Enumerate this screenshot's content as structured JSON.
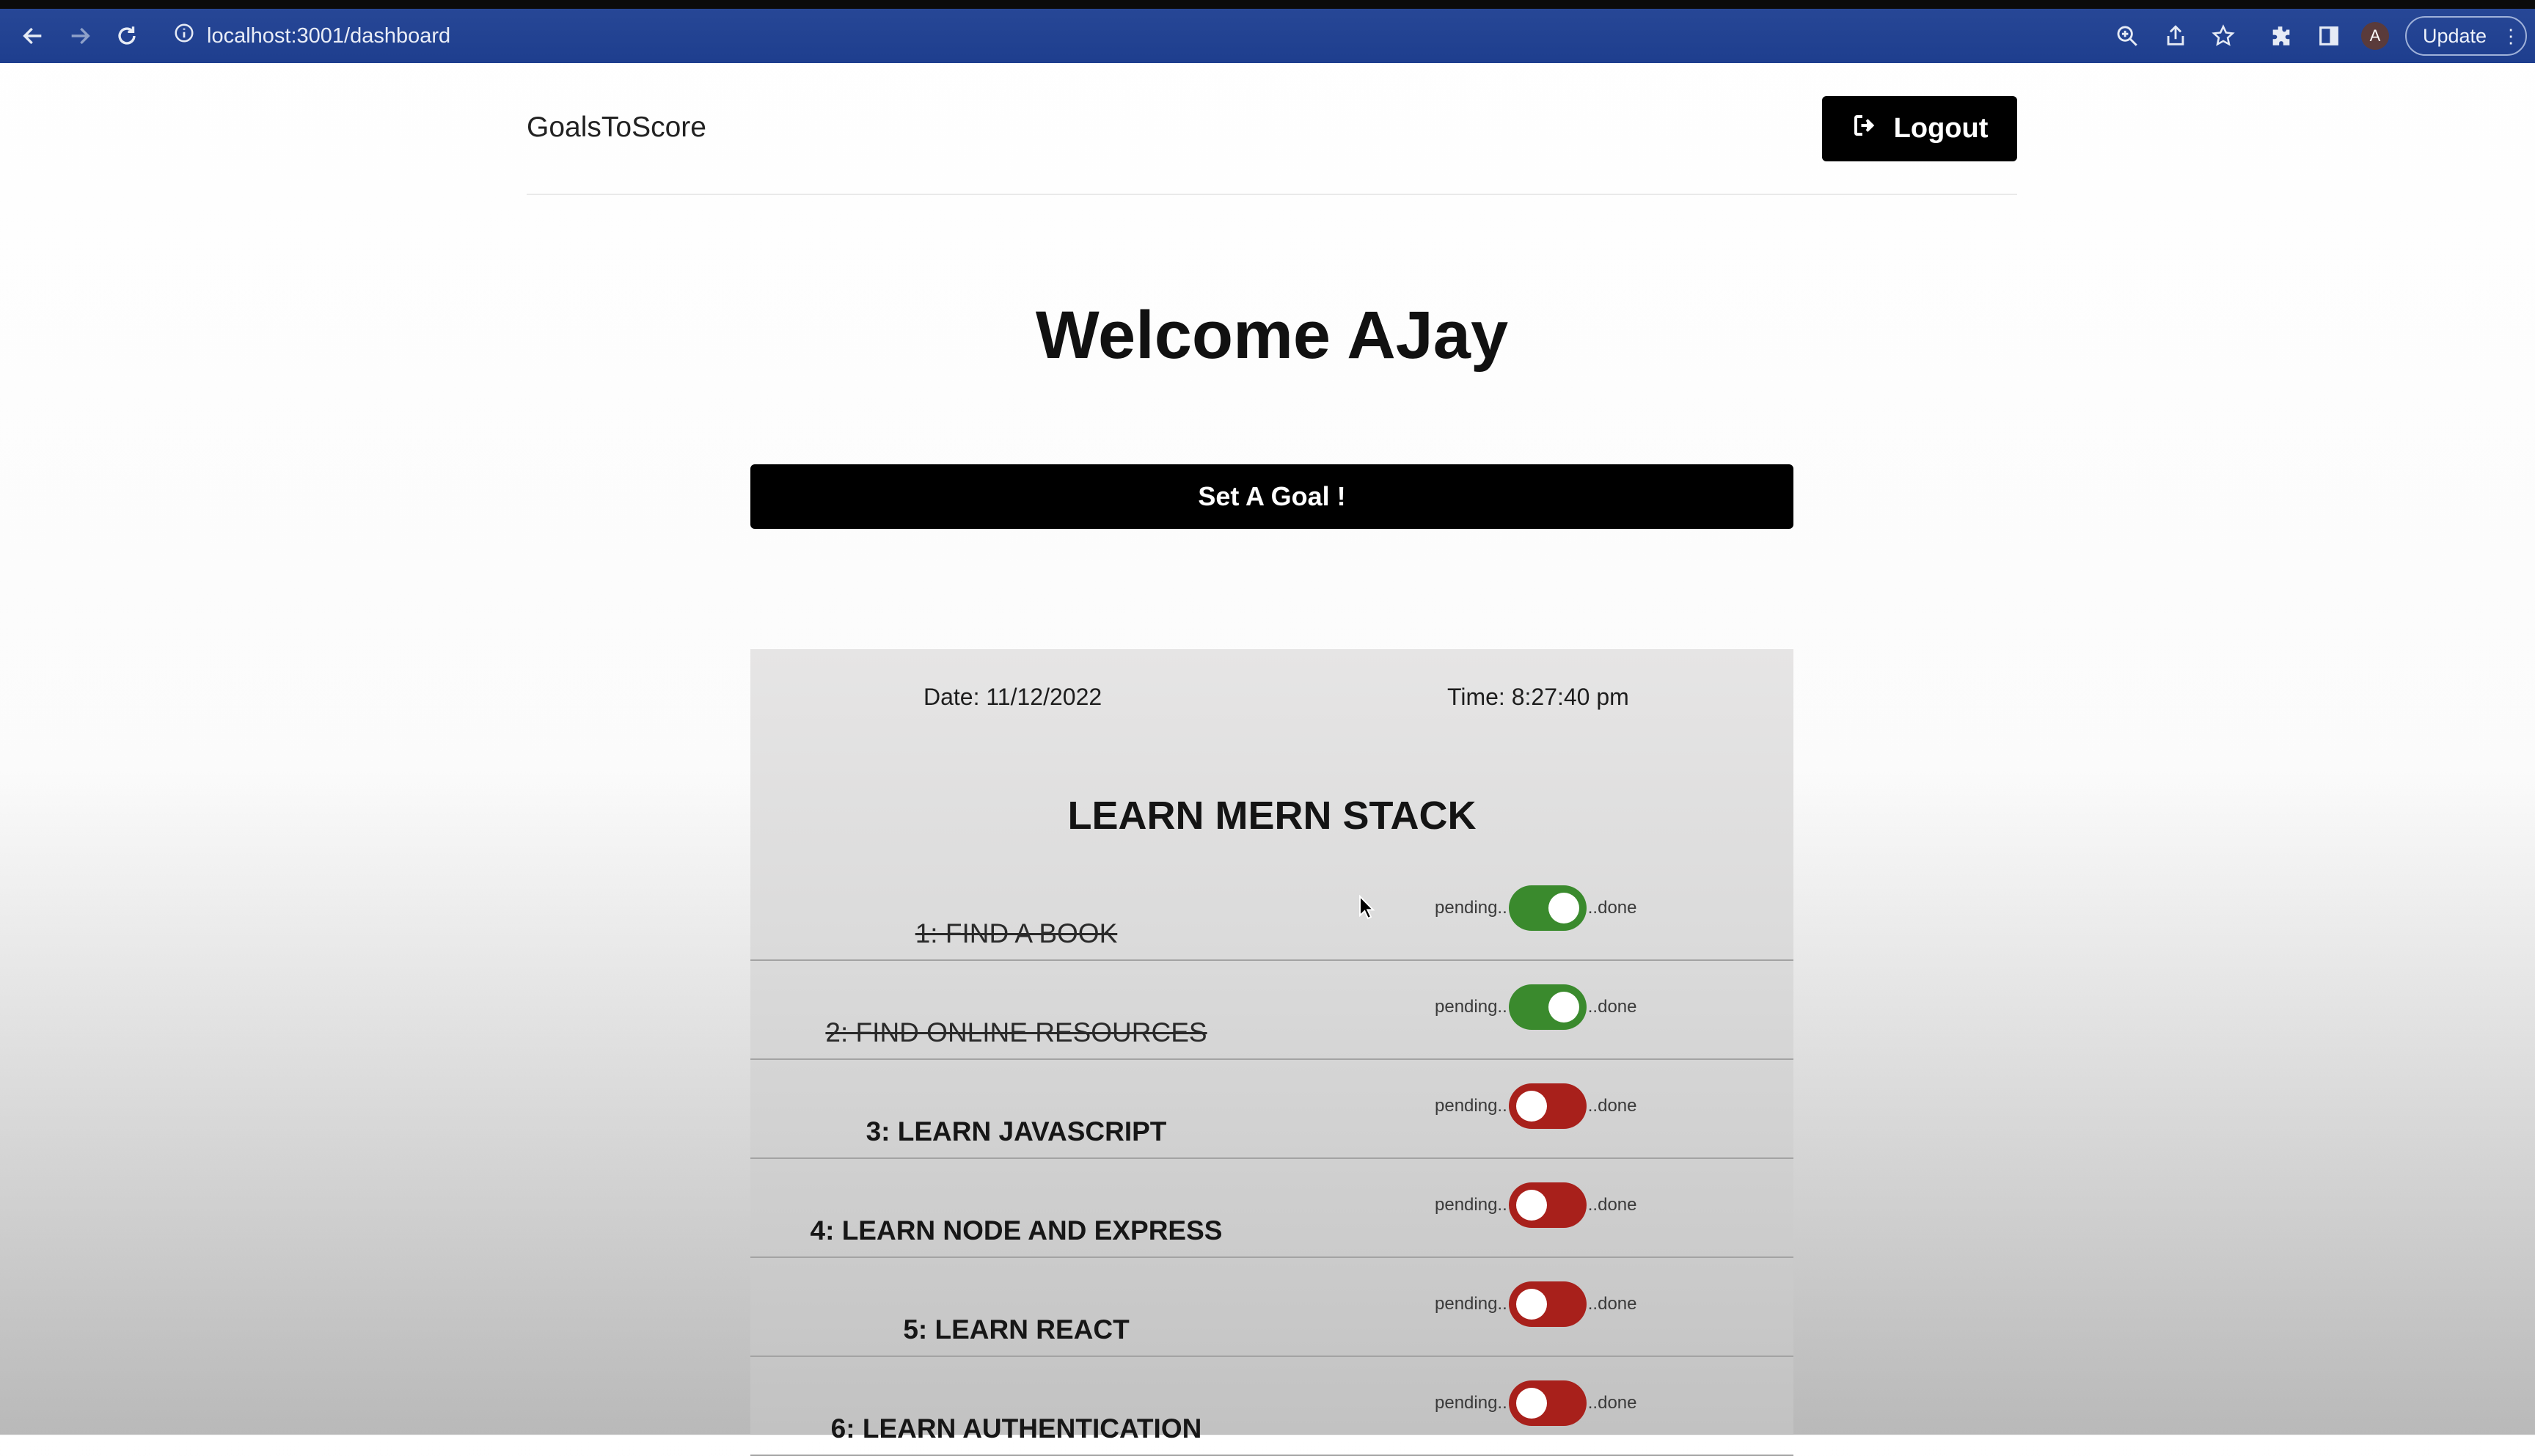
{
  "browser": {
    "url": "localhost:3001/dashboard",
    "profile_initial": "A",
    "update_label": "Update",
    "icons": [
      "back-icon",
      "forward-icon",
      "reload-icon",
      "info-icon",
      "zoom-icon",
      "share-icon",
      "star-icon",
      "extensions-icon",
      "sidepanel-icon",
      "kebab-menu-icon"
    ]
  },
  "header": {
    "brand": "GoalsToScore",
    "logout_label": "Logout"
  },
  "main": {
    "welcome": "Welcome AJay",
    "set_goal_label": "Set A Goal !"
  },
  "goal": {
    "date": "Date: 11/12/2022",
    "time": "Time: 8:27:40 pm",
    "title": "LEARN MERN STACK",
    "pending_label": "pending..",
    "done_label": "..done",
    "tasks": [
      {
        "label": "1: FIND A BOOK",
        "done": true
      },
      {
        "label": "2: FIND ONLINE RESOURCES",
        "done": true
      },
      {
        "label": "3: LEARN JAVASCRIPT",
        "done": false
      },
      {
        "label": "4: LEARN NODE AND EXPRESS",
        "done": false
      },
      {
        "label": "5: LEARN REACT",
        "done": false
      },
      {
        "label": "6: LEARN AUTHENTICATION",
        "done": false
      }
    ]
  },
  "colors": {
    "browser_bar": "#2b4a97",
    "toggle_on": "#3a8a2d",
    "toggle_off": "#a8201b",
    "button_bg": "#000000"
  }
}
